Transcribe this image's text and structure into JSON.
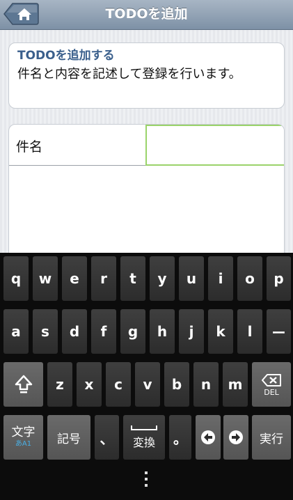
{
  "header": {
    "title": "TODOを追加"
  },
  "info": {
    "title": "TODOを追加する",
    "description": "件名と内容を記述して登録を行います。"
  },
  "form": {
    "subject_label": "件名",
    "subject_value": "",
    "subject_placeholder": ""
  },
  "keyboard": {
    "row1": [
      "q",
      "w",
      "e",
      "r",
      "t",
      "y",
      "u",
      "i",
      "o",
      "p"
    ],
    "row2": [
      "a",
      "s",
      "d",
      "f",
      "g",
      "h",
      "j",
      "k",
      "l",
      "ー"
    ],
    "row3": [
      "z",
      "x",
      "c",
      "v",
      "b",
      "n",
      "m"
    ],
    "del_label": "DEL",
    "moji_label": "文字",
    "moji_sub": "あA1",
    "kigou_label": "記号",
    "comma": "、",
    "henkan_label": "変換",
    "period": "。",
    "jikkou_label": "実行",
    "colors": {
      "key": "#353535",
      "key_special": "#5f5f5f",
      "accent": "#49b0e6"
    }
  },
  "icons": {
    "home": "home-icon",
    "shift": "shift-icon",
    "backspace": "backspace-icon",
    "left": "arrow-left-icon",
    "right": "arrow-right-icon",
    "menu": "menu-dots-icon"
  },
  "colors": {
    "header": "#8d9fb2",
    "info_title": "#3a5f8c",
    "input_focus": "#9ad36a"
  }
}
